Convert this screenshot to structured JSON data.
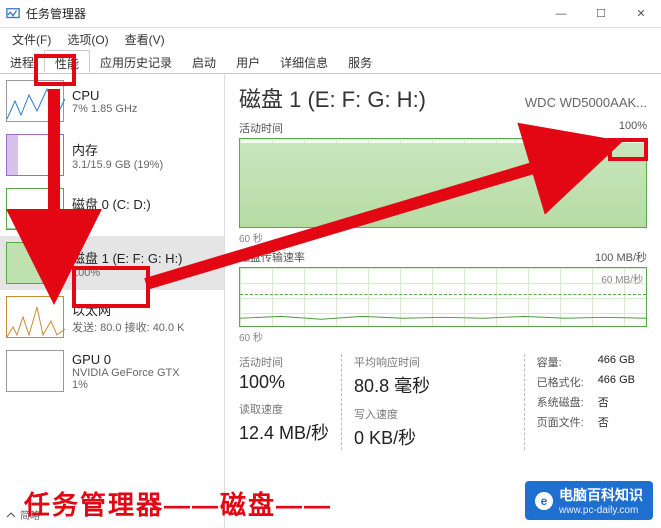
{
  "window": {
    "title": "任务管理器"
  },
  "win_controls": {
    "min": "—",
    "max": "☐",
    "close": "✕"
  },
  "menu": {
    "file": "文件(F)",
    "options": "选项(O)",
    "view": "查看(V)"
  },
  "tabs": {
    "processes": "进程",
    "performance": "性能",
    "history": "应用历史记录",
    "startup": "启动",
    "users": "用户",
    "details": "详细信息",
    "services": "服务"
  },
  "sidebar": {
    "items": [
      {
        "title": "CPU",
        "sub": "7% 1.85 GHz"
      },
      {
        "title": "内存",
        "sub": "3.1/15.9 GB (19%)"
      },
      {
        "title": "磁盘 0 (C: D:)",
        "sub": "3%"
      },
      {
        "title": "磁盘 1 (E: F: G: H:)",
        "sub": "100%"
      },
      {
        "title": "以太网",
        "sub": "发送: 80.0  接收: 40.0 K"
      },
      {
        "title": "GPU 0",
        "sub": "NVIDIA GeForce GTX",
        "sub2": "1%"
      }
    ]
  },
  "detail": {
    "title": "磁盘 1 (E: F: G: H:)",
    "model": "WDC WD5000AAK...",
    "active_label": "活动时间",
    "active_max": "100%",
    "xaxis_left": "60 秒",
    "throughput_label": "磁盘传输速率",
    "throughput_max": "100 MB/秒",
    "throughput_inner": "60 MB/秒",
    "stats": {
      "active_time_label": "活动时间",
      "active_time_val": "100%",
      "avg_resp_label": "平均响应时间",
      "avg_resp_val": "80.8 毫秒",
      "read_label": "读取速度",
      "read_val": "12.4 MB/秒",
      "write_label": "写入速度",
      "write_val": "0 KB/秒"
    },
    "right": {
      "capacity_label": "容量:",
      "capacity_val": "466 GB",
      "formatted_label": "已格式化:",
      "formatted_val": "466 GB",
      "sysdisk_label": "系统磁盘:",
      "sysdisk_val": "否",
      "pagefile_label": "页面文件:",
      "pagefile_val": "否"
    }
  },
  "footer": {
    "brief": "简略"
  },
  "annotation": {
    "text": "任务管理器——磁盘——"
  },
  "watermark": {
    "brand": "电脑百科知识",
    "url": "www.pc-daily.com",
    "icon": "e"
  },
  "chart_data": [
    {
      "type": "area",
      "title": "活动时间",
      "ylabel": "%",
      "ylim": [
        0,
        100
      ],
      "xrange_seconds": 60,
      "values_pct_approx": [
        100,
        100,
        100,
        100,
        100,
        100,
        100,
        100,
        100,
        100,
        100,
        100
      ]
    },
    {
      "type": "line",
      "title": "磁盘传输速率",
      "ylabel": "MB/秒",
      "ylim": [
        0,
        100
      ],
      "reference_line": 60,
      "xrange_seconds": 60,
      "values_mbps_approx": [
        12,
        12,
        12,
        12,
        12,
        12,
        12,
        12,
        12,
        12,
        12,
        12
      ]
    }
  ]
}
